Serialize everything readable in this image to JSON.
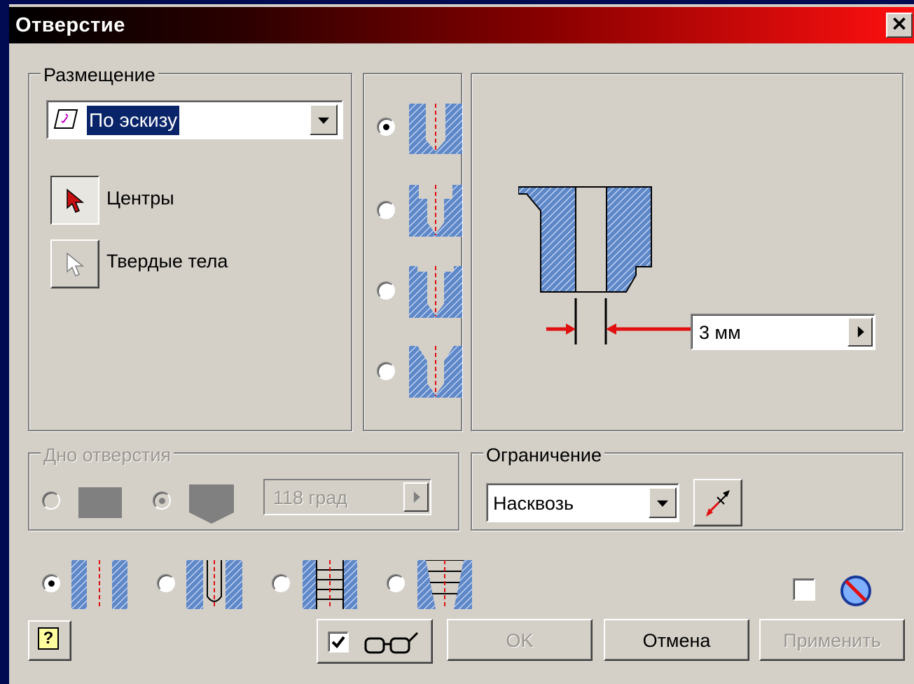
{
  "window": {
    "title": "Отверстие",
    "close_glyph": "✕"
  },
  "placement": {
    "group_label": "Размещение",
    "dropdown_value": "По эскизу",
    "dropdown_icon": "sketch-plane-icon",
    "centers_label": "Центры",
    "solids_label": "Твердые тела"
  },
  "hole_types": {
    "selected_index": 0,
    "options": [
      "drilled",
      "counterbore",
      "spotface",
      "countersink"
    ]
  },
  "preview": {
    "diameter_value": "3 мм"
  },
  "drill_point": {
    "group_label": "Дно отверстия",
    "angle_value": "118 град",
    "selected": "angled"
  },
  "termination": {
    "group_label": "Ограничение",
    "value": "Насквозь",
    "flip_icon": "flip-direction-icon"
  },
  "thread_types": {
    "selected_index": 0,
    "options": [
      "simple",
      "clearance",
      "tapped",
      "taper-tapped"
    ]
  },
  "buttons": {
    "ok": "OK",
    "cancel": "Отмена",
    "apply": "Применить",
    "help_glyph": "?",
    "preview_checked": true
  },
  "colors": {
    "accent_red": "#e01010",
    "hatch_blue": "#5f88c8",
    "dialog_bg": "#d4d0c8",
    "desktop_bg": "#000b52"
  }
}
